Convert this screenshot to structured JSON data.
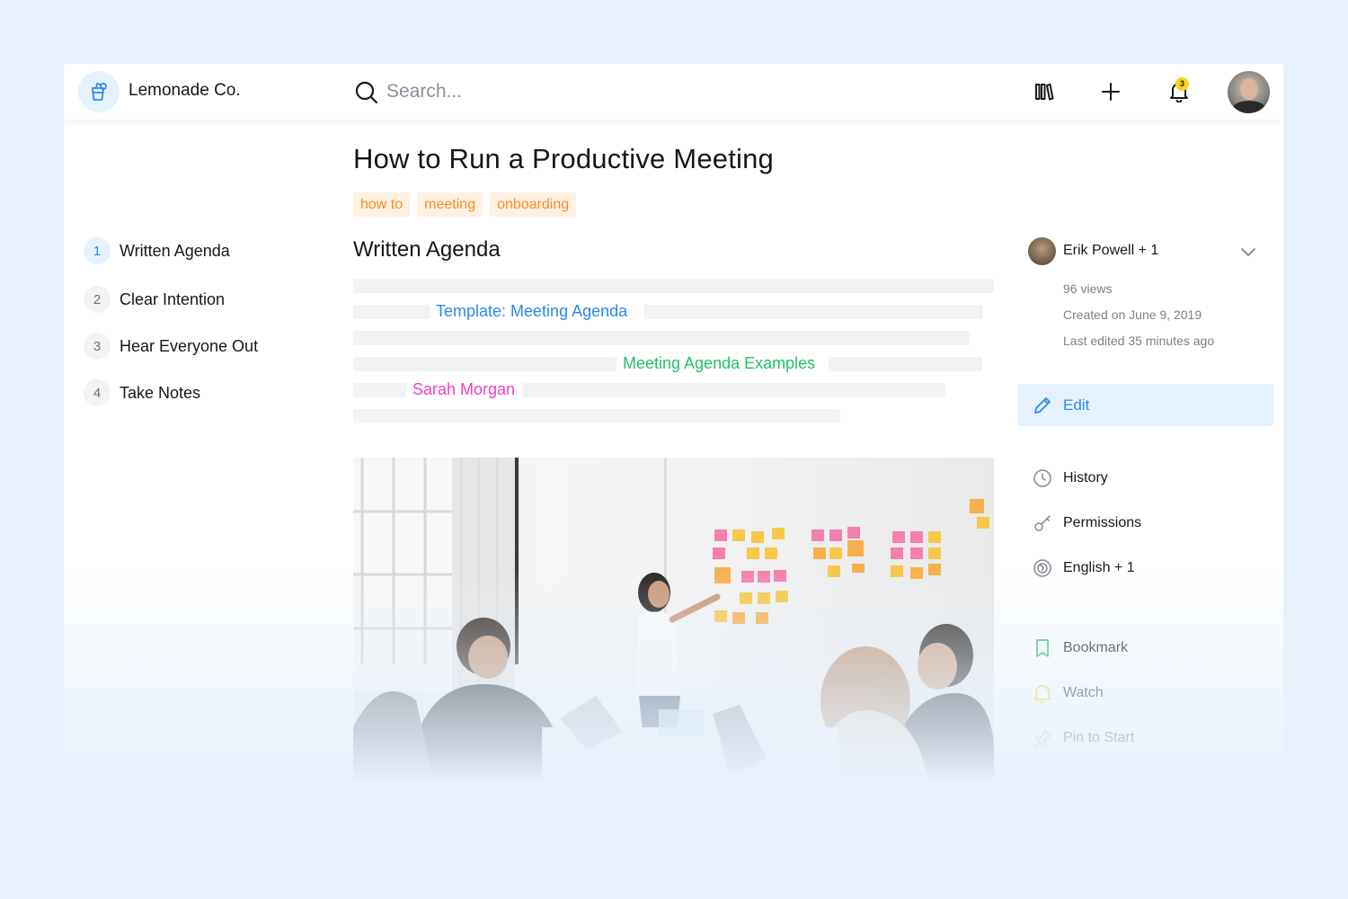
{
  "app": {
    "brand": "Lemonade Co."
  },
  "search": {
    "placeholder": "Search..."
  },
  "header": {
    "notification_count": "3"
  },
  "toc": [
    {
      "num": "1",
      "label": "Written Agenda",
      "active": true
    },
    {
      "num": "2",
      "label": "Clear Intention",
      "active": false
    },
    {
      "num": "3",
      "label": "Hear Everyone Out",
      "active": false
    },
    {
      "num": "4",
      "label": "Take Notes",
      "active": false
    }
  ],
  "article": {
    "title": "How to Run a Productive Meeting",
    "tags": [
      "how to",
      "meeting",
      "onboarding"
    ],
    "section_title": "Written Agenda",
    "links": {
      "template": "Template: Meeting Agenda",
      "examples": "Meeting Agenda Examples",
      "person": "Sarah Morgan"
    }
  },
  "sidebar": {
    "author": "Erik Powell + 1",
    "views": "96 views",
    "created": "Created on June 9, 2019",
    "edited": "Last edited 35 minutes ago",
    "edit_label": "Edit",
    "actions": {
      "history": "History",
      "permissions": "Permissions",
      "language": "English + 1",
      "bookmark": "Bookmark",
      "watch": "Watch",
      "pin": "Pin to Start"
    }
  },
  "colors": {
    "accent": "#2a8ae8",
    "tag_text": "#ff8a1e",
    "tag_bg": "#fff1e3",
    "link_blue": "#2a8ae8",
    "link_green": "#22c261",
    "link_pink": "#f23fbf",
    "badge": "#ffd21f"
  }
}
